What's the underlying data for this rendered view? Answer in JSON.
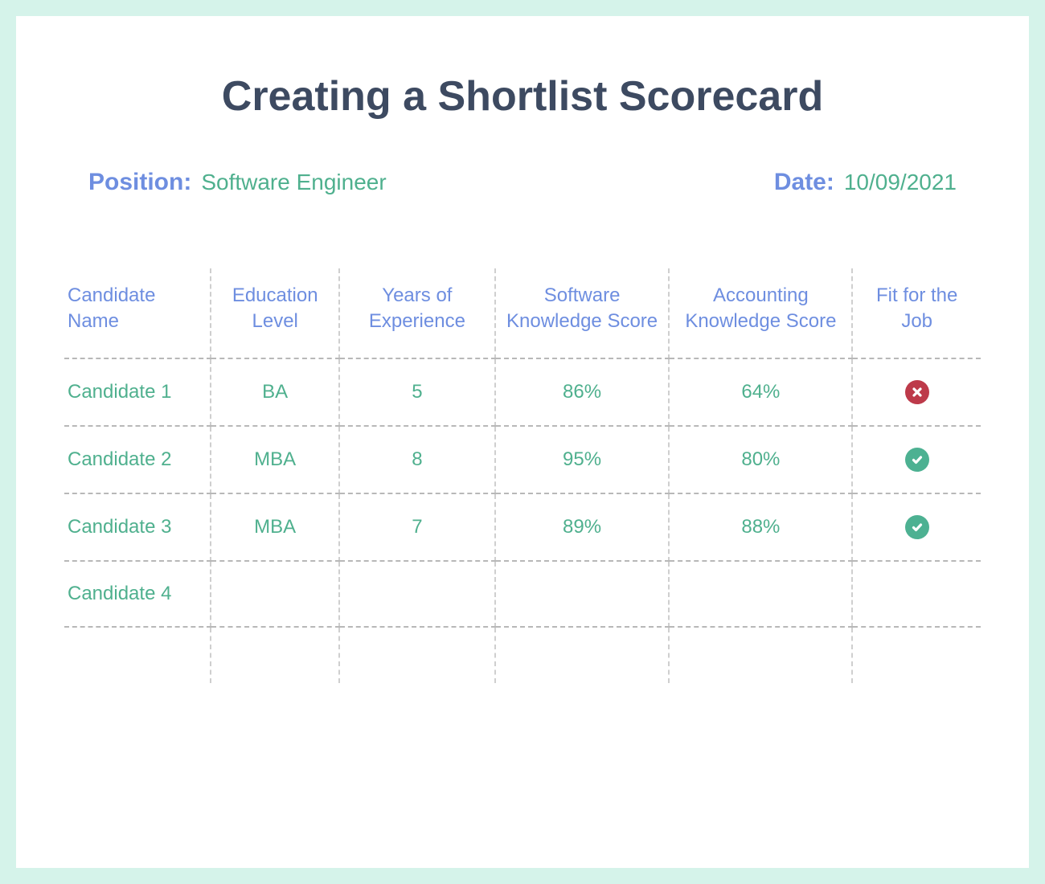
{
  "title": "Creating a Shortlist Scorecard",
  "meta": {
    "position_label": "Position:",
    "position_value": "Software Engineer",
    "date_label": "Date:",
    "date_value": "10/09/2021"
  },
  "table": {
    "headers": {
      "name": "Candidate Name",
      "education": "Education Level",
      "experience": "Years of Experience",
      "software": "Software Knowledge Score",
      "accounting": "Accounting Knowledge Score",
      "fit": "Fit for the Job"
    },
    "rows": [
      {
        "name": "Candidate 1",
        "education": "BA",
        "experience": "5",
        "software": "86%",
        "accounting": "64%",
        "fit": "cross"
      },
      {
        "name": "Candidate 2",
        "education": "MBA",
        "experience": "8",
        "software": "95%",
        "accounting": "80%",
        "fit": "check"
      },
      {
        "name": "Candidate 3",
        "education": "MBA",
        "experience": "7",
        "software": "89%",
        "accounting": "88%",
        "fit": "check"
      },
      {
        "name": "Candidate 4",
        "education": "",
        "experience": "",
        "software": "",
        "accounting": "",
        "fit": ""
      }
    ]
  }
}
